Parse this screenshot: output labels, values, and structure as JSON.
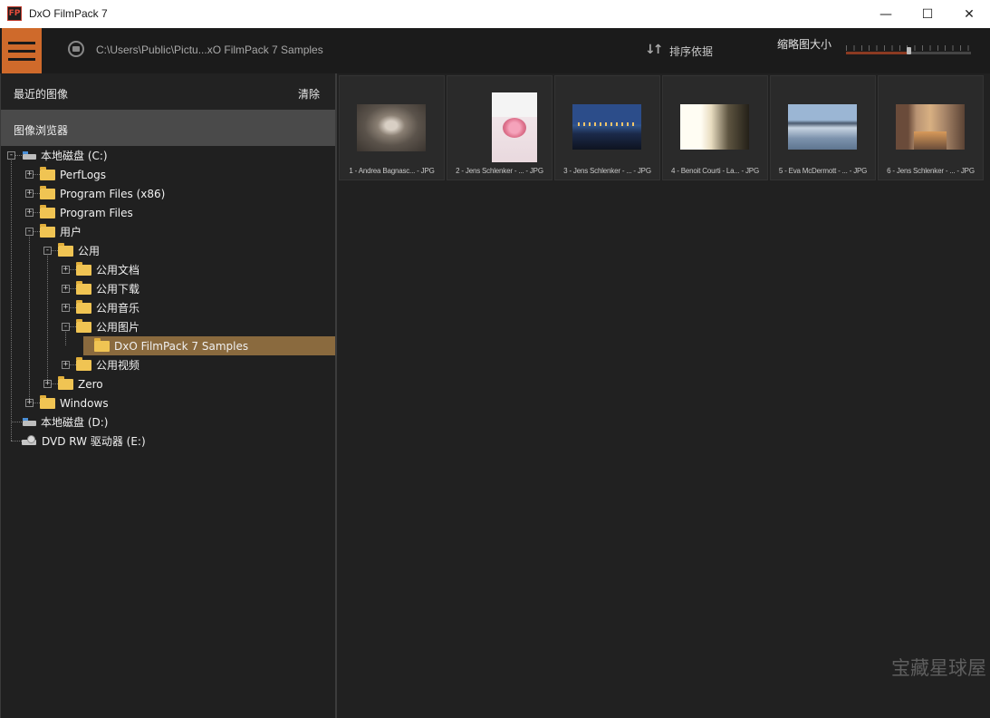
{
  "window": {
    "title": "DxO FilmPack 7",
    "app_icon_text": "FP",
    "minimize": "—",
    "maximize": "☐",
    "close": "✕"
  },
  "toolbar": {
    "path": "C:\\Users\\Public\\Pictu...xO FilmPack 7 Samples",
    "sort_label": "排序依据",
    "thumb_size_label": "缩略图大小",
    "thumb_size_level": 0.5
  },
  "sidebar": {
    "recent_label": "最近的图像",
    "clear_label": "清除",
    "browser_label": "图像浏览器"
  },
  "tree": [
    {
      "label": "本地磁盘 (C:)",
      "type": "drive",
      "level": 0,
      "expander": "-"
    },
    {
      "label": "PerfLogs",
      "type": "folder",
      "level": 1,
      "expander": "+"
    },
    {
      "label": "Program Files (x86)",
      "type": "folder",
      "level": 1,
      "expander": "+"
    },
    {
      "label": "Program Files",
      "type": "folder",
      "level": 1,
      "expander": "+"
    },
    {
      "label": "用户",
      "type": "folder",
      "level": 1,
      "expander": "-"
    },
    {
      "label": "公用",
      "type": "folder",
      "level": 2,
      "expander": "-"
    },
    {
      "label": "公用文档",
      "type": "folder",
      "level": 3,
      "expander": "+"
    },
    {
      "label": "公用下载",
      "type": "folder",
      "level": 3,
      "expander": "+"
    },
    {
      "label": "公用音乐",
      "type": "folder",
      "level": 3,
      "expander": "+"
    },
    {
      "label": "公用图片",
      "type": "folder",
      "level": 3,
      "expander": "-"
    },
    {
      "label": "DxO FilmPack 7 Samples",
      "type": "folder",
      "level": 4,
      "expander": "",
      "selected": true
    },
    {
      "label": "公用视频",
      "type": "folder",
      "level": 3,
      "expander": "+"
    },
    {
      "label": "Zero",
      "type": "folder",
      "level": 2,
      "expander": "+"
    },
    {
      "label": "Windows",
      "type": "folder",
      "level": 1,
      "expander": "+"
    },
    {
      "label": "本地磁盘 (D:)",
      "type": "drive",
      "level": 0,
      "expander": ""
    },
    {
      "label": "DVD RW 驱动器 (E:)",
      "type": "dvd",
      "level": 0,
      "expander": ""
    }
  ],
  "thumbnails": [
    {
      "caption": "1 - Andrea Bagnasc... - JPG"
    },
    {
      "caption": "2 - Jens Schlenker - ... - JPG"
    },
    {
      "caption": "3 - Jens Schlenker - ... - JPG"
    },
    {
      "caption": "4 - Benoit Courti - La... - JPG"
    },
    {
      "caption": "5 - Eva McDermott - ... - JPG"
    },
    {
      "caption": "6 - Jens Schlenker - ... - JPG"
    }
  ],
  "watermark": "宝藏星球屋",
  "colors": {
    "accent": "#cf6a2b",
    "selection": "#8a6a3e",
    "folder": "#f0c453"
  }
}
